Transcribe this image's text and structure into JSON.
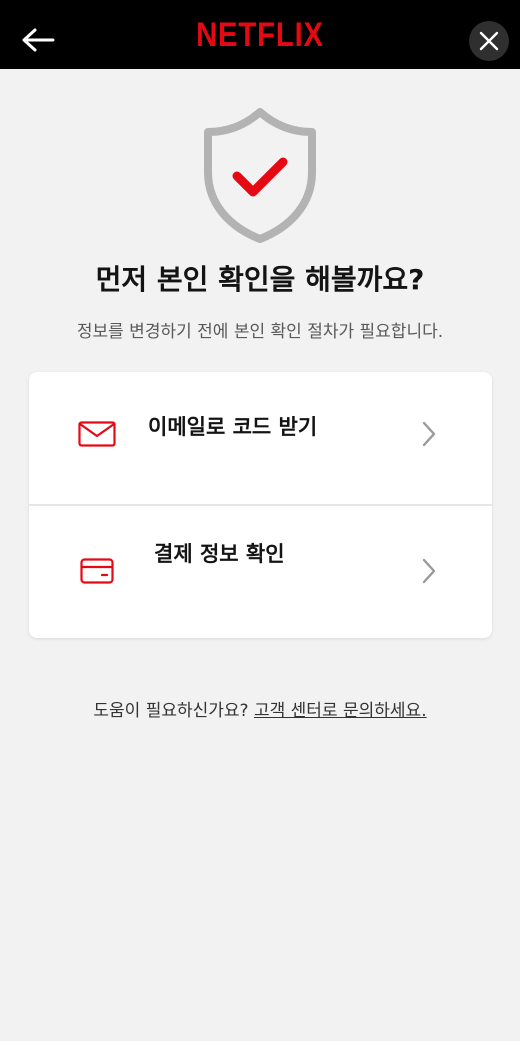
{
  "header": {
    "logo_text": "NETFLIX",
    "back_icon": "arrow-left-icon",
    "close_icon": "close-icon"
  },
  "colors": {
    "brand": "#e50914",
    "header_bg": "#000000",
    "page_bg": "#f2f2f2",
    "shield_outline": "#b3b3b3"
  },
  "main": {
    "shield_icon": "shield-check-icon",
    "title": "먼저 본인 확인을 해볼까요?",
    "subtitle": "정보를 변경하기 전에 본인 확인 절차가 필요합니다."
  },
  "options": [
    {
      "label": "이메일로 코드 받기",
      "icon": "envelope-icon"
    },
    {
      "label": "결제 정보 확인",
      "icon": "credit-card-icon"
    }
  ],
  "footer": {
    "prompt": "도움이 필요하신가요? ",
    "link": "고객 센터로 문의하세요."
  }
}
